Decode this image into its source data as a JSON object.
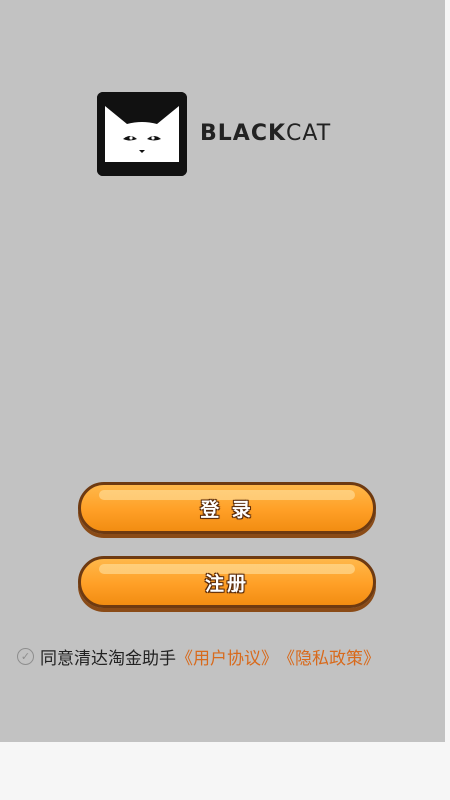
{
  "logo": {
    "brand_black": "BLACK",
    "brand_cat": "CAT",
    "icon": "black-cat-logo-icon"
  },
  "buttons": {
    "login_label": "登 录",
    "register_label": "注册"
  },
  "agreement": {
    "checkbox_icon": "check-circle-icon",
    "checked": true,
    "text": "同意清达淘金助手",
    "user_agreement_link": "《用户协议》",
    "privacy_policy_link": "《隐私政策》"
  },
  "colors": {
    "background": "#c2c2c2",
    "button_fill": "#ff9f26",
    "button_border": "#6e3a11",
    "link": "#d86a1c"
  }
}
